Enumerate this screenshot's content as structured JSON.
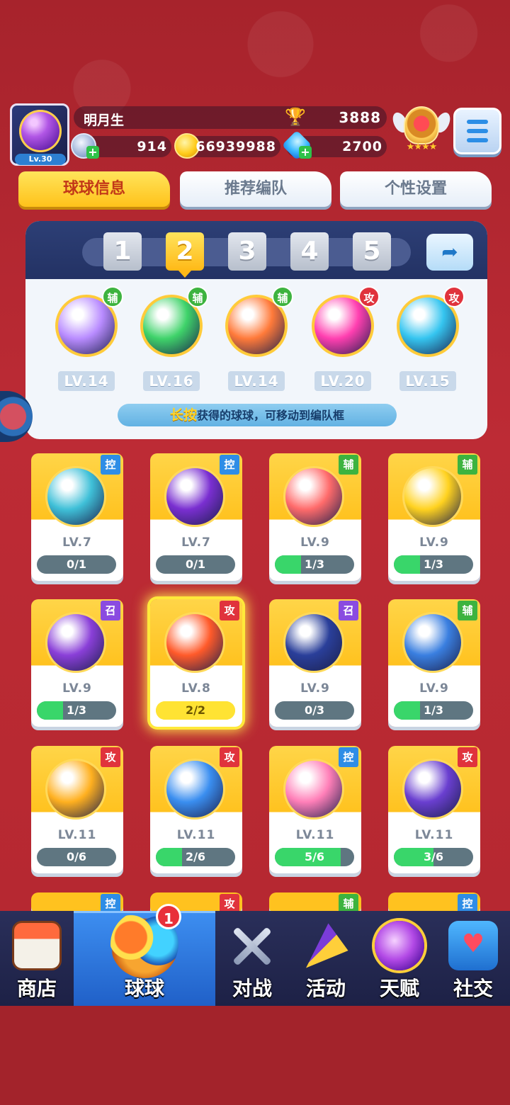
{
  "player": {
    "name": "明月生",
    "level": "Lv.30",
    "trophy_score": "3888",
    "silver": "914",
    "gold": "66939988",
    "gems": "2700"
  },
  "tabs": [
    {
      "label": "球球信息",
      "active": true
    },
    {
      "label": "推荐编队",
      "active": false
    },
    {
      "label": "个性设置",
      "active": false
    }
  ],
  "team": {
    "slots": [
      "1",
      "2",
      "3",
      "4",
      "5"
    ],
    "active_slot": "2",
    "share_icon": "share-icon",
    "balls": [
      {
        "level": "LV.14",
        "tag": "辅",
        "color": "#b98cff"
      },
      {
        "level": "LV.16",
        "tag": "辅",
        "color": "#3fd36a"
      },
      {
        "level": "LV.14",
        "tag": "辅",
        "color": "#ff7a3a"
      },
      {
        "level": "LV.20",
        "tag": "攻",
        "color": "#ff3fb0"
      },
      {
        "level": "LV.15",
        "tag": "攻",
        "color": "#35c5f0"
      }
    ],
    "hint_highlight": "长按",
    "hint_text": "获得的球球，可移动到编队框"
  },
  "collection": [
    {
      "level": "LV.7",
      "tag": "控",
      "progress_text": "0/1",
      "progress": 0.0,
      "color": "#3fc0d8"
    },
    {
      "level": "LV.7",
      "tag": "控",
      "progress_text": "0/1",
      "progress": 0.0,
      "color": "#7a2fd1"
    },
    {
      "level": "LV.9",
      "tag": "辅",
      "progress_text": "1/3",
      "progress": 0.333,
      "color": "#ff6b6b"
    },
    {
      "level": "LV.9",
      "tag": "辅",
      "progress_text": "1/3",
      "progress": 0.333,
      "color": "#ffd21f"
    },
    {
      "level": "LV.9",
      "tag": "召",
      "progress_text": "1/3",
      "progress": 0.333,
      "color": "#8a3fd8"
    },
    {
      "level": "LV.8",
      "tag": "攻",
      "progress_text": "2/2",
      "progress": 1.0,
      "color": "#ff5a2a"
    },
    {
      "level": "LV.9",
      "tag": "召",
      "progress_text": "0/3",
      "progress": 0.0,
      "color": "#2a3f9a"
    },
    {
      "level": "LV.9",
      "tag": "辅",
      "progress_text": "1/3",
      "progress": 0.333,
      "color": "#3a7fe0"
    },
    {
      "level": "LV.11",
      "tag": "攻",
      "progress_text": "0/6",
      "progress": 0.0,
      "color": "#ffb01f"
    },
    {
      "level": "LV.11",
      "tag": "攻",
      "progress_text": "2/6",
      "progress": 0.333,
      "color": "#3a8ef0"
    },
    {
      "level": "LV.11",
      "tag": "控",
      "progress_text": "5/6",
      "progress": 0.833,
      "color": "#ff7fb8"
    },
    {
      "level": "LV.11",
      "tag": "攻",
      "progress_text": "3/6",
      "progress": 0.5,
      "color": "#6a3fd0"
    }
  ],
  "partial_row_tags": [
    "控",
    "攻",
    "辅",
    "控"
  ],
  "nav": [
    {
      "label": "商店",
      "icon": "shop-icon",
      "active": false
    },
    {
      "label": "球球",
      "icon": "balls-icon",
      "active": true
    },
    {
      "label": "对战",
      "icon": "crossed-swords-icon",
      "active": false
    },
    {
      "label": "活动",
      "icon": "party-popper-icon",
      "active": false
    },
    {
      "label": "天赋",
      "icon": "talent-planet-icon",
      "active": false
    },
    {
      "label": "社交",
      "icon": "chat-heart-icon",
      "active": false
    }
  ],
  "nav_badge": "1",
  "colors": {
    "tag_assist": "#3db33f",
    "tag_attack": "#e0333c",
    "tag_control": "#2e8de6",
    "tag_summon": "#8a4be0"
  }
}
